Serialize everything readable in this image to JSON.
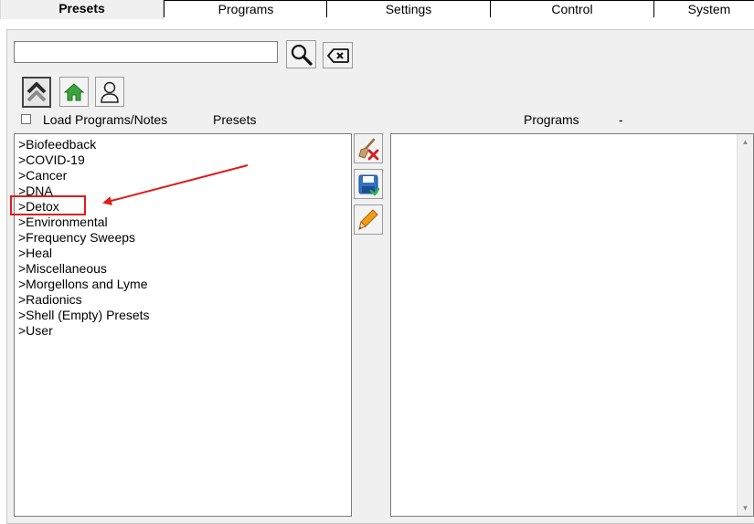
{
  "tabs": [
    {
      "label": "Presets",
      "active": true
    },
    {
      "label": "Programs",
      "active": false
    },
    {
      "label": "Settings",
      "active": false
    },
    {
      "label": "Control",
      "active": false
    },
    {
      "label": "System",
      "active": false
    }
  ],
  "search": {
    "value": "",
    "placeholder": ""
  },
  "icons": {
    "search": "magnifier-icon",
    "clear": "backspace-icon",
    "up": "double-chevron-up-icon",
    "home": "home-icon",
    "user": "user-icon",
    "delete": "broom-delete-icon",
    "save": "save-disk-icon",
    "edit": "pencil-icon"
  },
  "options": {
    "load_programs_notes": {
      "label": "Load Programs/Notes",
      "checked": false
    }
  },
  "headers": {
    "presets": "Presets",
    "programs": "Programs",
    "programs_suffix": "-"
  },
  "presets": [
    ">Biofeedback",
    ">COVID-19",
    ">Cancer",
    ">DNA",
    ">Detox",
    ">Environmental",
    ">Frequency Sweeps",
    ">Heal",
    ">Miscellaneous",
    ">Morgellons and Lyme",
    ">Radionics",
    ">Shell (Empty) Presets",
    ">User"
  ],
  "programs": [],
  "annotation": {
    "highlighted_item": ">Detox",
    "color": "#e01b1b"
  },
  "colors": {
    "panel": "#f0f0f0",
    "annotation": "#e01b1b",
    "home_green": "#3aa53a"
  }
}
